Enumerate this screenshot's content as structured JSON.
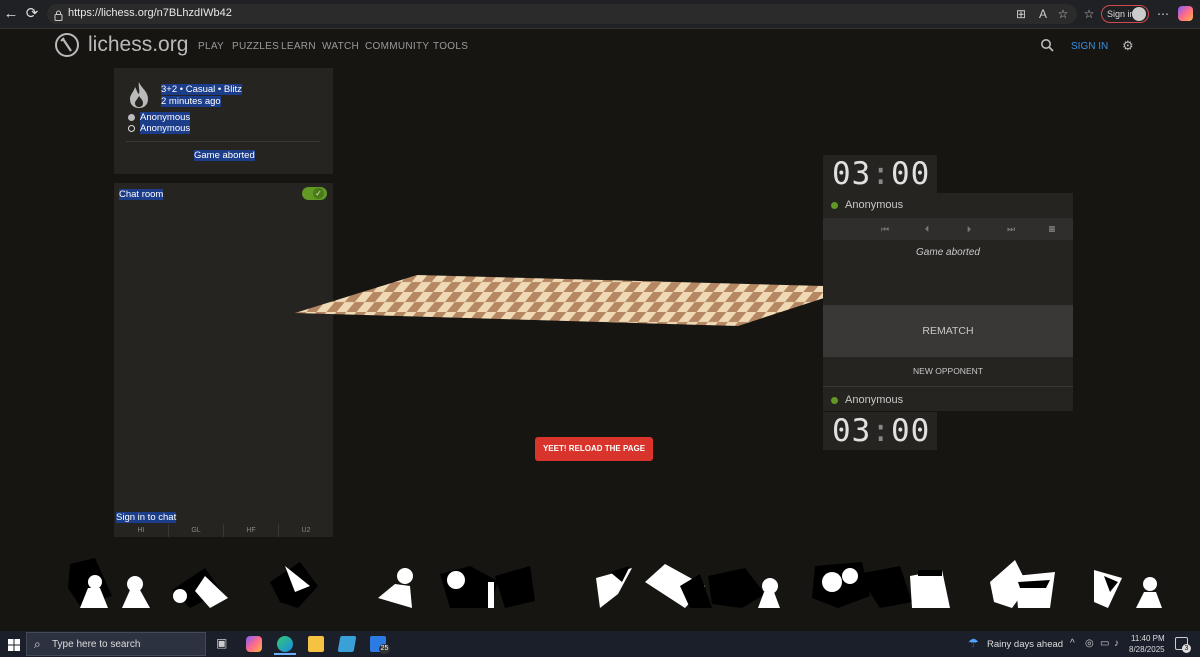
{
  "browser": {
    "url": "https://lichess.org/n7BLhzdIWb42",
    "profile_label": "Sign in"
  },
  "site": {
    "logo_text": "lichess.org",
    "nav": [
      "PLAY",
      "PUZZLES",
      "LEARN",
      "WATCH",
      "COMMUNITY",
      "TOOLS"
    ],
    "signin": "SIGN IN"
  },
  "game_meta": {
    "line1": "3+2 • Casual • Blitz",
    "line2": "2 minutes ago",
    "player1": "Anonymous",
    "player2": "Anonymous",
    "status": "Game aborted"
  },
  "chat": {
    "title": "Chat room",
    "toggle_on": true,
    "signin": "Sign in to chat",
    "presets": [
      "HI",
      "GL",
      "HF",
      "U2"
    ]
  },
  "reload_button": "YEET! RELOAD THE PAGE",
  "side": {
    "clock_top_min": "03",
    "clock_top_sec": "00",
    "clock_sep": ":",
    "top_player": "Anonymous",
    "moves_status": "Game aborted",
    "rematch": "REMATCH",
    "new_opponent": "NEW OPPONENT",
    "bottom_player": "Anonymous",
    "clock_bottom_min": "03",
    "clock_bottom_sec": "00"
  },
  "taskbar": {
    "search_placeholder": "Type here to search",
    "mail_badge": "25",
    "weather": "Rainy days ahead",
    "time": "11:40 PM",
    "date": "8/28/2025",
    "notif_count": "3"
  },
  "colors": {
    "accent": "#3692e7",
    "reload": "#d8342b",
    "online": "#629924",
    "board_light": "#f0d9b5",
    "board_dark": "#b58863"
  }
}
